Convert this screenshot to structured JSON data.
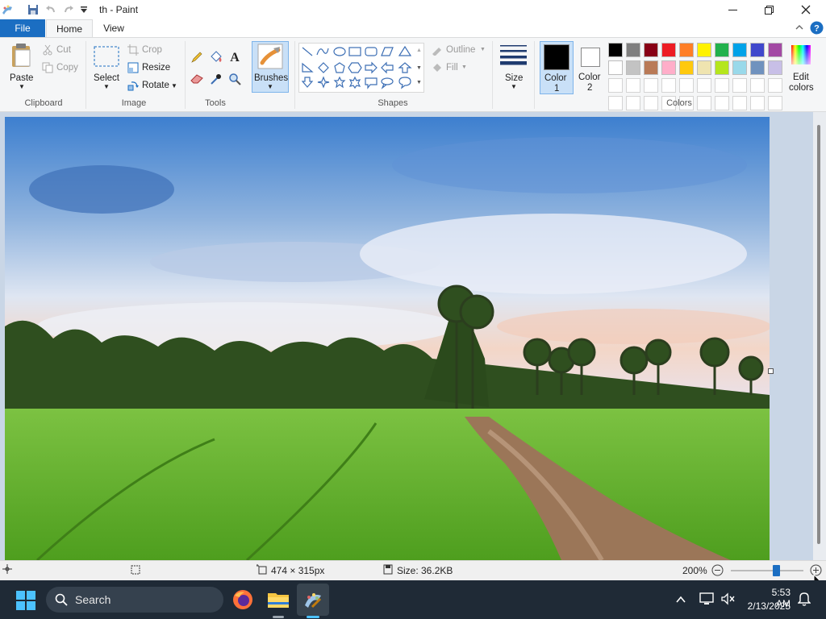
{
  "window": {
    "title": "th - Paint"
  },
  "tabs": [
    {
      "label": "File"
    },
    {
      "label": "Home"
    },
    {
      "label": "View"
    }
  ],
  "ribbon": {
    "clipboard": {
      "label": "Clipboard",
      "paste": "Paste",
      "cut": "Cut",
      "copy": "Copy"
    },
    "image": {
      "label": "Image",
      "select": "Select",
      "crop": "Crop",
      "resize": "Resize",
      "rotate": "Rotate"
    },
    "tools": {
      "label": "Tools"
    },
    "brushes": {
      "label": "Brushes"
    },
    "shapes": {
      "label": "Shapes",
      "outline": "Outline",
      "fill": "Fill"
    },
    "size": {
      "label": "Size"
    },
    "color1": {
      "label1": "Color",
      "label2": "1"
    },
    "color2": {
      "label1": "Color",
      "label2": "2"
    },
    "colors": {
      "label": "Colors",
      "edit_label1": "Edit",
      "edit_label2": "colors",
      "row1": [
        "#000000",
        "#7f7f7f",
        "#880015",
        "#ed1c24",
        "#ff7f27",
        "#fff200",
        "#22b14c",
        "#00a2e8",
        "#3f48cc",
        "#a349a4"
      ],
      "row2": [
        "#ffffff",
        "#c3c3c3",
        "#b97a57",
        "#ffaec9",
        "#ffc90e",
        "#efe4b0",
        "#b5e61d",
        "#99d9ea",
        "#7092be",
        "#c8bfe7"
      ],
      "row3": [
        "#ffffff",
        "#ffffff",
        "#ffffff",
        "#ffffff",
        "#ffffff",
        "#ffffff",
        "#ffffff",
        "#ffffff",
        "#ffffff",
        "#ffffff"
      ],
      "row4": [
        "#ffffff",
        "#ffffff",
        "#ffffff",
        "#ffffff",
        "#ffffff",
        "#ffffff",
        "#ffffff",
        "#ffffff",
        "#ffffff",
        "#ffffff"
      ]
    }
  },
  "status": {
    "dimensions": "474 × 315px",
    "size": "Size: 36.2KB",
    "zoom": "200%",
    "zoom_level": 0.62
  },
  "taskbar": {
    "search": "Search",
    "time": "5:53 AM",
    "date": "2/13/2025"
  },
  "accent": "#1b6ec2"
}
